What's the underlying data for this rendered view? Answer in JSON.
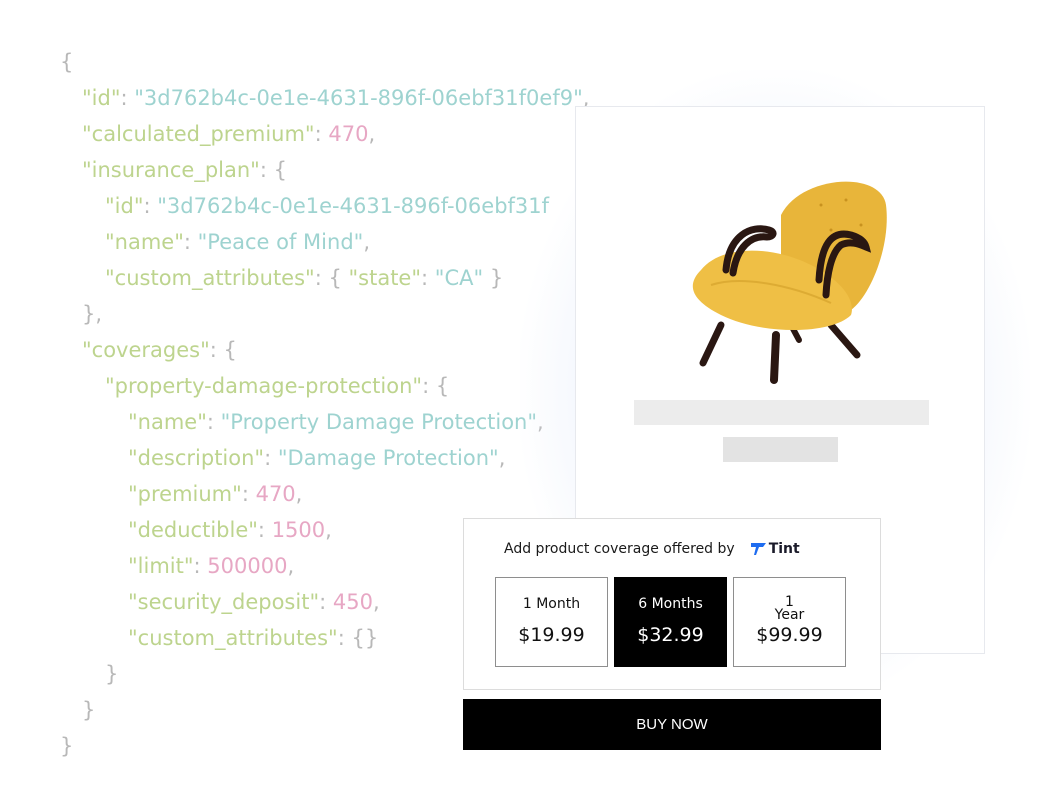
{
  "code_lines": [
    "{",
    "\"id\": \"3d762b4c-0e1e-4631-896f-06ebf31f0ef9\",",
    "\"calculated_premium\": 470,",
    "\"insurance_plan\": {",
    "\"id\": \"3d762b4c-0e1e-4631-896f-06ebf31f",
    "\"name\": \"Peace of Mind\",",
    "\"custom_attributes\": { \"state\": \"CA\" }",
    "},",
    "\"coverages\": {",
    "\"property-damage-protection\": {",
    "\"name\": \"Property Damage Protection\",",
    "\"description\": \"Damage Protection\",",
    "\"premium\": 470,",
    "\"deductible\": 1500,",
    "\"limit\": 500000,",
    "\"security_deposit\": 450,",
    "\"custom_attributes\": {}",
    "}",
    "}",
    "}"
  ],
  "widget": {
    "heading": "Add product coverage offered by",
    "brand": "Tint",
    "options": [
      {
        "duration": "1 Month",
        "price": "$19.99",
        "selected": false
      },
      {
        "duration": "6 Months",
        "price": "$32.99",
        "selected": true
      },
      {
        "duration_line1": "1",
        "duration_line2": "Year",
        "price": "$99.99",
        "selected": false
      }
    ]
  },
  "buy_button": "BUY NOW",
  "colors": {
    "key": "#bdd48e",
    "string": "#9ed3d0",
    "number": "#e7a7c4",
    "punctuation": "#b8b8b8",
    "selected_option": "#000000",
    "buy_button": "#000000"
  },
  "icons": [
    "tint-logo-icon",
    "armchair-product-image"
  ]
}
